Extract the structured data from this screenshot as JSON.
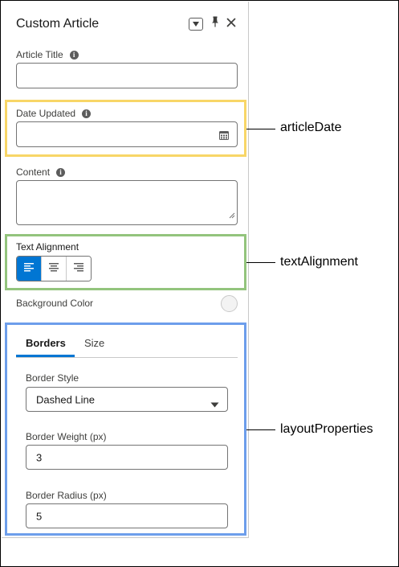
{
  "panel": {
    "title": "Custom Article",
    "header_icons": [
      "chevron-down-icon",
      "pin-icon",
      "close-icon"
    ]
  },
  "fields": {
    "article_title": {
      "label": "Article Title",
      "value": ""
    },
    "date_updated": {
      "label": "Date Updated",
      "value": ""
    },
    "content": {
      "label": "Content",
      "value": ""
    },
    "text_alignment": {
      "label": "Text Alignment",
      "options": [
        "align-left-icon",
        "align-center-icon",
        "align-right-icon"
      ],
      "selected": "align-left-icon"
    },
    "background_color": {
      "label": "Background Color"
    }
  },
  "layout_tabs": {
    "tabs": [
      "Borders",
      "Size"
    ],
    "active": "Borders",
    "border_style": {
      "label": "Border Style",
      "value": "Dashed Line"
    },
    "border_weight": {
      "label": "Border Weight (px)",
      "value": "3"
    },
    "border_radius": {
      "label": "Border Radius (px)",
      "value": "5"
    }
  },
  "annotations": [
    "articleDate",
    "textAlignment",
    "layoutProperties"
  ],
  "colors": {
    "accent_blue": "#0176d3",
    "highlight_yellow": "#f8d667",
    "highlight_green": "#93c47d",
    "highlight_blue": "#6d9eeb"
  }
}
